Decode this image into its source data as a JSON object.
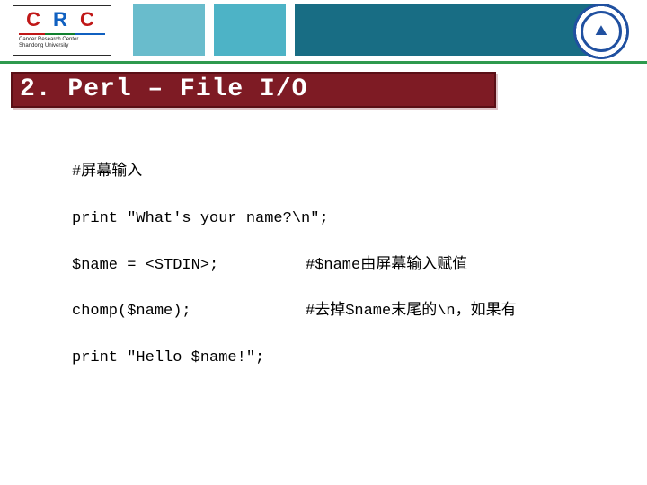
{
  "logo": {
    "letters": [
      "C",
      "R",
      "C"
    ],
    "subtitle1": "Cancer Research Center",
    "subtitle2": "Shandong University"
  },
  "seal": {
    "year": ""
  },
  "title": "2. Perl – File I/O",
  "lines": [
    {
      "code": "#屏幕输入",
      "comment": ""
    },
    {
      "code": "print \"What's your name?\\n\";",
      "comment": ""
    },
    {
      "code": "$name = <STDIN>;",
      "comment": "#$name由屏幕输入赋值"
    },
    {
      "code": "chomp($name);",
      "comment": "#去掉$name末尾的\\n，如果有"
    },
    {
      "code": "print \"Hello $name!\";",
      "comment": ""
    }
  ]
}
